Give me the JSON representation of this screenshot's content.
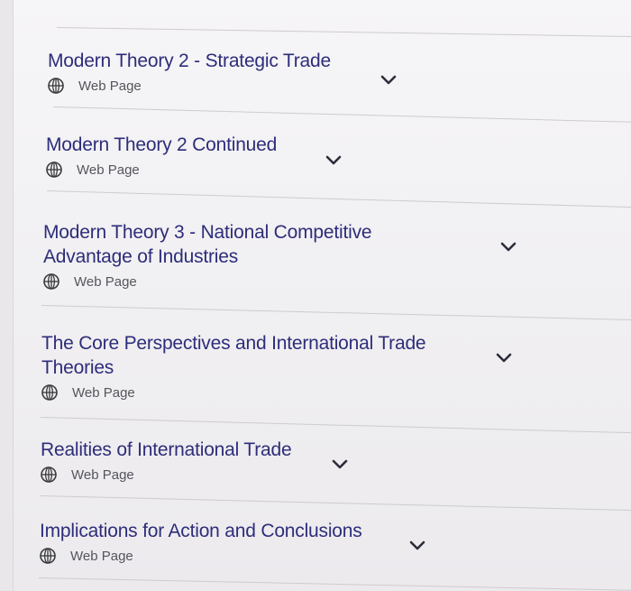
{
  "items": [
    {
      "title": "Modern Theory 2 - Strategic Trade",
      "type": "Web Page"
    },
    {
      "title": "Modern Theory 2 Continued",
      "type": "Web Page"
    },
    {
      "title": "Modern Theory 3 - National Competitive Advantage of Industries",
      "type": "Web Page"
    },
    {
      "title": "The Core Perspectives and International Trade Theories",
      "type": "Web Page"
    },
    {
      "title": "Realities of International Trade",
      "type": "Web Page"
    },
    {
      "title": "Implications for Action and Conclusions",
      "type": "Web Page"
    }
  ],
  "icons": {
    "type_icon": "globe-icon",
    "expand_icon": "chevron-down-icon"
  },
  "colors": {
    "title": "#2d2d7a",
    "meta": "#55555d",
    "divider": "#cfcbd1"
  }
}
